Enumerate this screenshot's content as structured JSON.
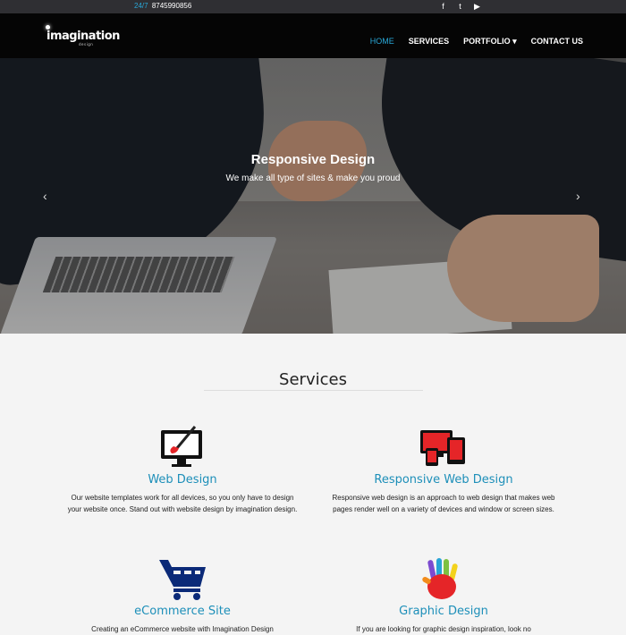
{
  "topbar": {
    "phone_prefix": "24/7",
    "phone": "8745990856",
    "social": [
      "facebook-icon",
      "twitter-icon",
      "youtube-icon"
    ]
  },
  "brand": {
    "name": "imagination",
    "sub": "design"
  },
  "nav": {
    "items": [
      "HOME",
      "SERVICES",
      "PORTFOLIO ▾",
      "CONTACT US"
    ]
  },
  "hero": {
    "title": "Responsive Design",
    "subtitle": "We make all type of sites & make you proud",
    "prev": "‹",
    "next": "›"
  },
  "services": {
    "title": "Services",
    "cards": [
      {
        "title": "Web Design",
        "text": "Our website templates work for all devices, so you only have to design your website once. Stand out with website design by imagination design."
      },
      {
        "title": "Responsive Web Design",
        "text": "Responsive web design is an approach to web design that makes web pages render well on a variety of devices and window or screen sizes."
      },
      {
        "title": "eCommerce Site",
        "text": "Creating an eCommerce website with Imagination Design"
      },
      {
        "title": "Graphic Design",
        "text": "If you are looking for graphic design inspiration, look no"
      }
    ]
  },
  "colors": {
    "accent": "#29a8d8",
    "heading": "#1d8fb9"
  }
}
